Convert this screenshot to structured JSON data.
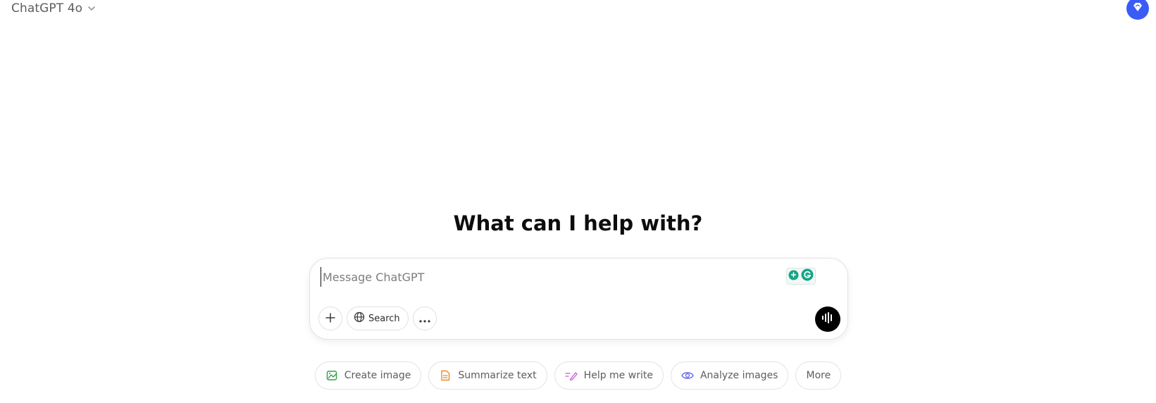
{
  "header": {
    "model_name": "ChatGPT 4o"
  },
  "main": {
    "headline": "What can I help with?"
  },
  "composer": {
    "placeholder": "Message ChatGPT",
    "value": "",
    "search_label": "Search"
  },
  "suggestions": [
    {
      "label": "Create image",
      "icon": "create-image-icon",
      "color": "#2ea043"
    },
    {
      "label": "Summarize text",
      "icon": "document-icon",
      "color": "#e8892b"
    },
    {
      "label": "Help me write",
      "icon": "pen-icon",
      "color": "#c95bd4"
    },
    {
      "label": "Analyze images",
      "icon": "eye-icon",
      "color": "#6a6ae8"
    },
    {
      "label": "More",
      "icon": "",
      "color": ""
    }
  ],
  "colors": {
    "badge_blue": "#3b5bf6",
    "grammarly_green": "#15a585"
  }
}
